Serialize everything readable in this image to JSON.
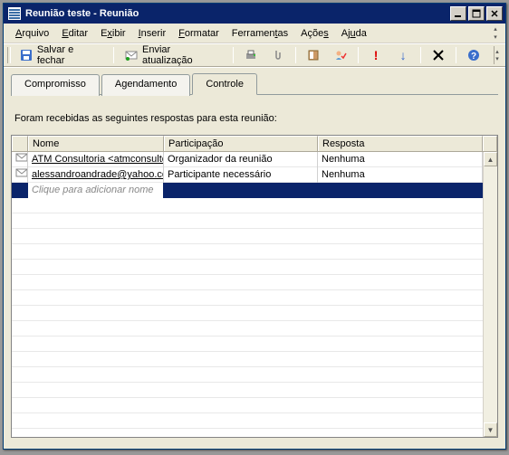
{
  "window": {
    "title": "Reunião teste - Reunião"
  },
  "menu": {
    "arquivo": "Arquivo",
    "editar": "Editar",
    "exibir": "Exibir",
    "inserir": "Inserir",
    "formatar": "Formatar",
    "ferramentas": "Ferramentas",
    "acoes": "Ações",
    "ajuda": "Ajuda"
  },
  "toolbar": {
    "save_close": "Salvar e fechar",
    "send_update": "Enviar atualização"
  },
  "tabs": {
    "compromisso": "Compromisso",
    "agendamento": "Agendamento",
    "controle": "Controle"
  },
  "status_text": "Foram recebidas as seguintes respostas para esta reunião:",
  "grid": {
    "headers": {
      "name": "Nome",
      "participation": "Participação",
      "response": "Resposta"
    },
    "rows": [
      {
        "name": "ATM Consultoria <atmconsultoria",
        "participation": "Organizador da reunião",
        "response": "Nenhuma"
      },
      {
        "name": "alessandroandrade@yahoo.com",
        "participation": "Participante necessário",
        "response": "Nenhuma"
      }
    ],
    "placeholder": "Clique para adicionar nome"
  }
}
